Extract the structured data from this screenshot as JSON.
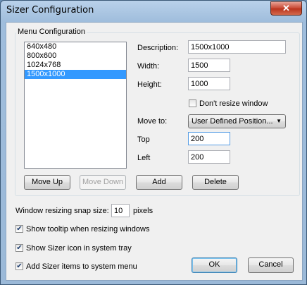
{
  "window": {
    "title": "Sizer Configuration",
    "close_glyph": "✕"
  },
  "menu_config": {
    "group_label": "Menu Configuration",
    "items": [
      "640x480",
      "800x600",
      "1024x768",
      "1500x1000"
    ],
    "selected_index": 3,
    "description_label": "Description:",
    "description_value": "1500x1000",
    "width_label": "Width:",
    "width_value": "1500",
    "height_label": "Height:",
    "height_value": "1000",
    "dont_resize_label": "Don't resize window",
    "dont_resize_checked": false,
    "move_to_label": "Move to:",
    "move_to_value": "User Defined Position...",
    "top_label": "Top",
    "top_value": "200",
    "left_label": "Left",
    "left_value": "200",
    "move_up_label": "Move Up",
    "move_down_label": "Move Down",
    "add_label": "Add",
    "delete_label": "Delete"
  },
  "options": {
    "snap_label": "Window resizing snap size:",
    "snap_value": "10",
    "snap_unit": "pixels",
    "tooltip_label": "Show tooltip when resizing windows",
    "tray_label": "Show Sizer icon in system tray",
    "system_menu_label": "Add Sizer items to system menu",
    "check_glyph": "✔"
  },
  "footer": {
    "ok_label": "OK",
    "cancel_label": "Cancel"
  }
}
